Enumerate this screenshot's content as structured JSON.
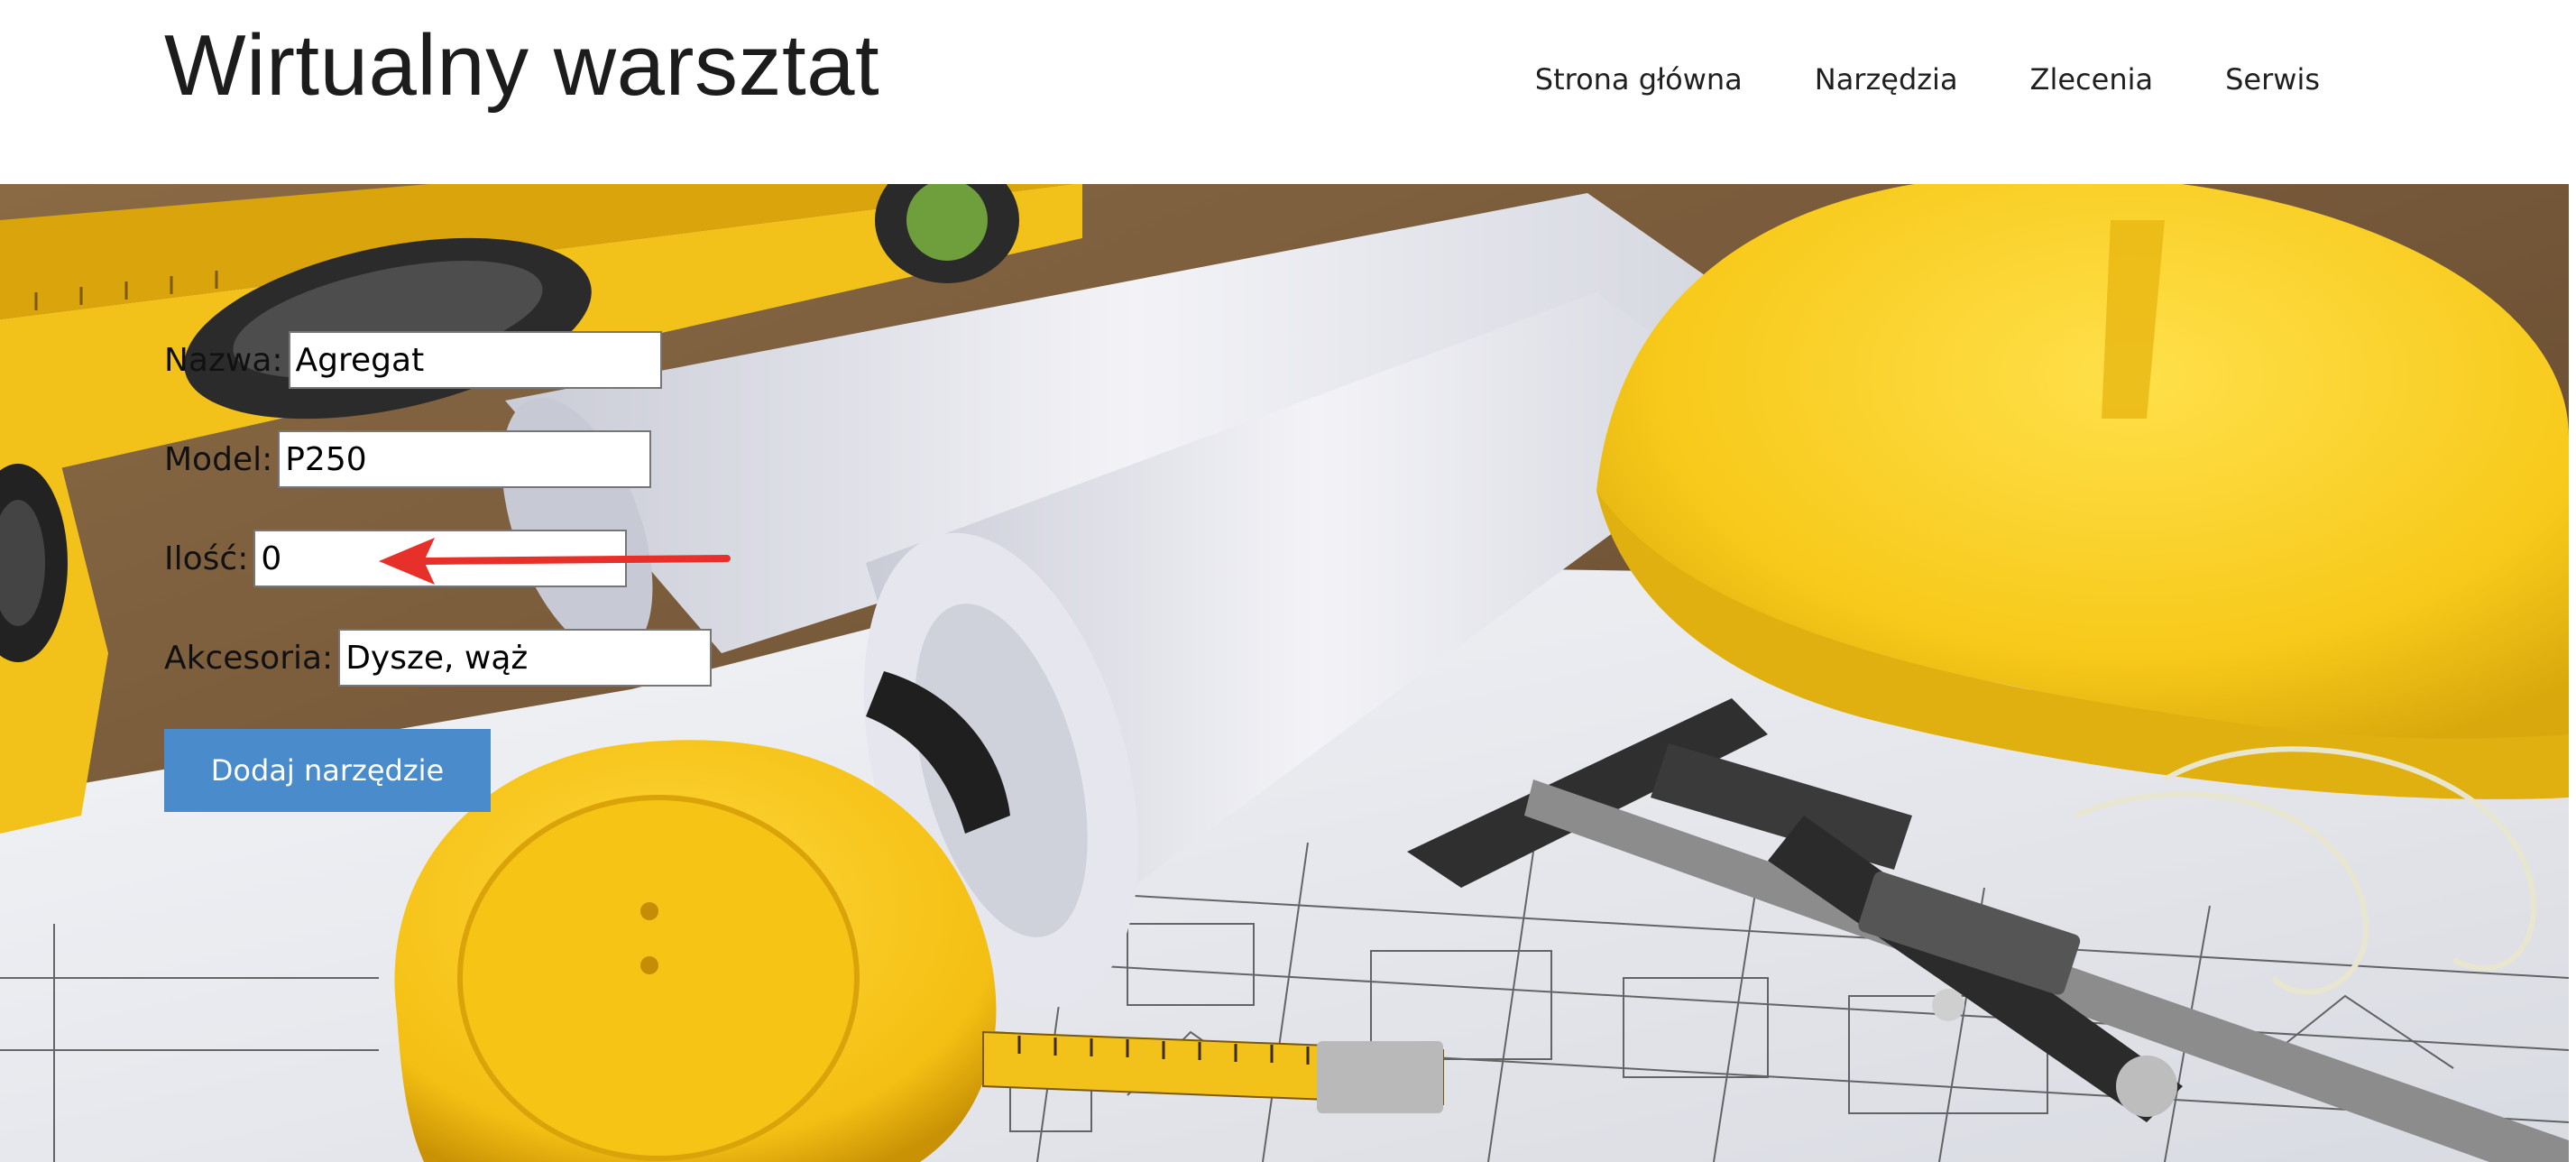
{
  "header": {
    "site_title": "Wirtualny warsztat",
    "nav": [
      "Strona główna",
      "Narzędzia",
      "Zlecenia",
      "Serwis"
    ]
  },
  "form": {
    "fields": [
      {
        "label": "Nazwa:",
        "value": "Agregat"
      },
      {
        "label": "Model:",
        "value": "P250"
      },
      {
        "label": "Ilość:",
        "value": "0"
      },
      {
        "label": "Akcesoria:",
        "value": "Dysze, wąż"
      }
    ],
    "submit_label": "Dodaj narzędzie"
  },
  "hero": {
    "description_icons": [
      "spirit-level",
      "blueprint-roll",
      "hard-hat",
      "tape-measure",
      "caliper",
      "architectural-drawing"
    ]
  },
  "colors": {
    "button": "#4a8ccb",
    "arrow": "#e8302a",
    "accent_yellow": "#f5c518"
  }
}
